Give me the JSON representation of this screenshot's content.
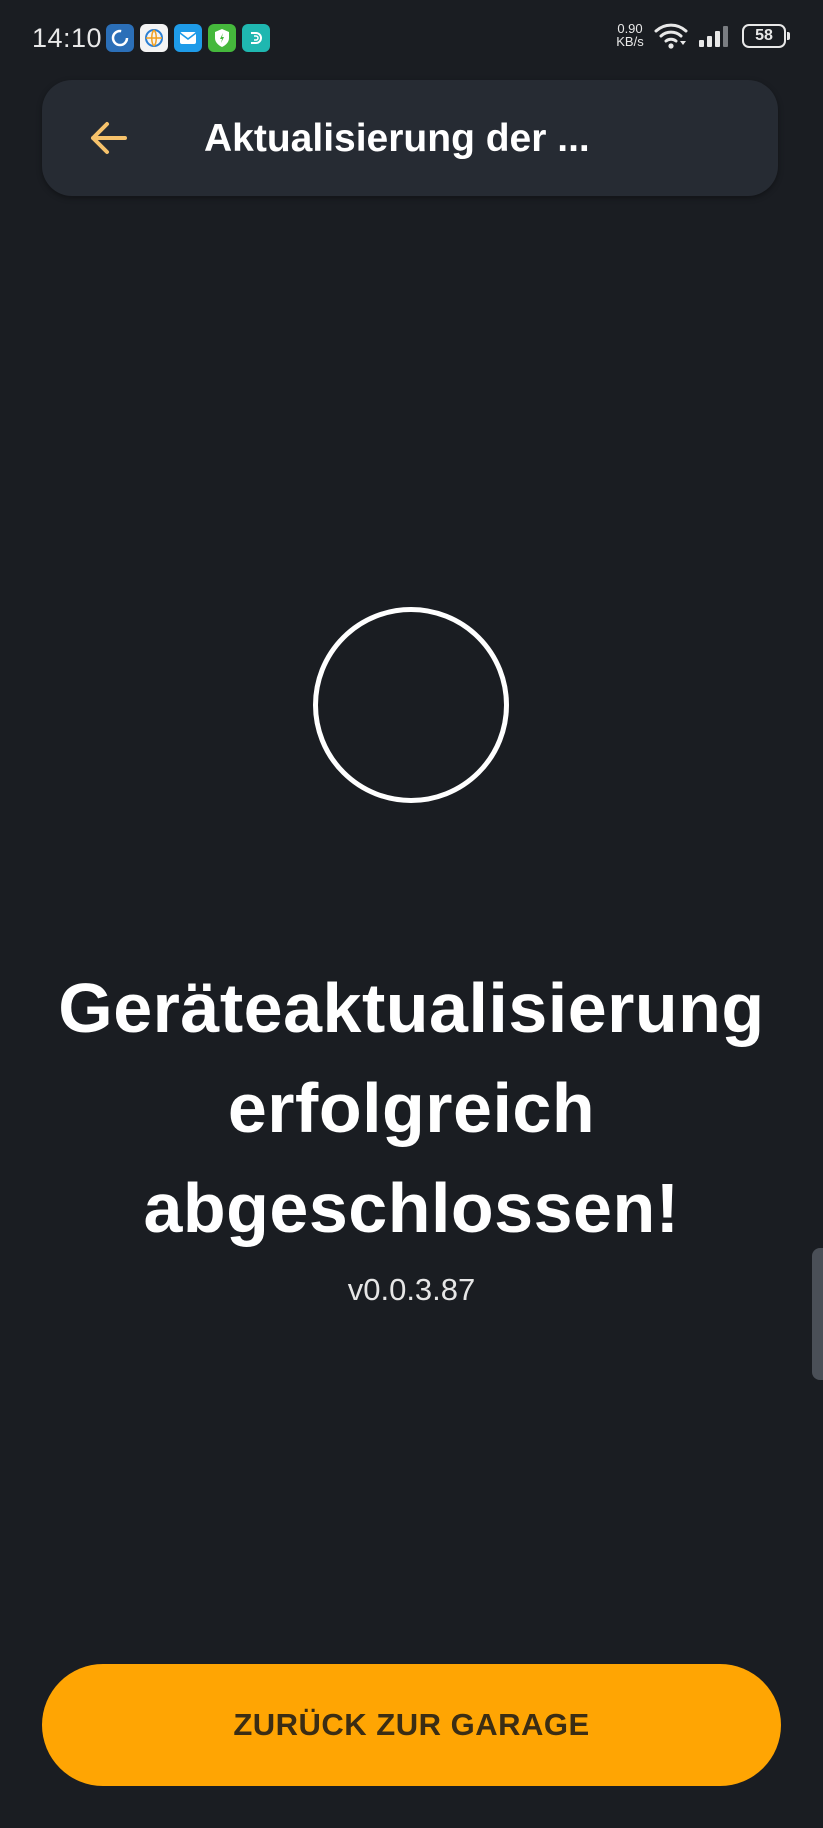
{
  "status_bar": {
    "time": "14:10",
    "net_speed_value": "0.90",
    "net_speed_unit": "KB/s",
    "battery": "58",
    "notification_icons": [
      "sync-icon",
      "browser-icon",
      "mail-icon",
      "security-shield-icon",
      "app-icon"
    ]
  },
  "header": {
    "title": "Aktualisierung der ...",
    "back_icon": "arrow-left-icon"
  },
  "main": {
    "message": "Geräteaktualisierung erfolgreich abgeschlossen!",
    "version": "v0.0.3.87"
  },
  "footer": {
    "button_label": "ZURÜCK ZUR GARAGE"
  },
  "colors": {
    "background": "#1a1d22",
    "header_background": "#262b33",
    "accent": "#ffa503",
    "back_arrow": "#f6c26b",
    "button_text": "#3b2d14"
  }
}
